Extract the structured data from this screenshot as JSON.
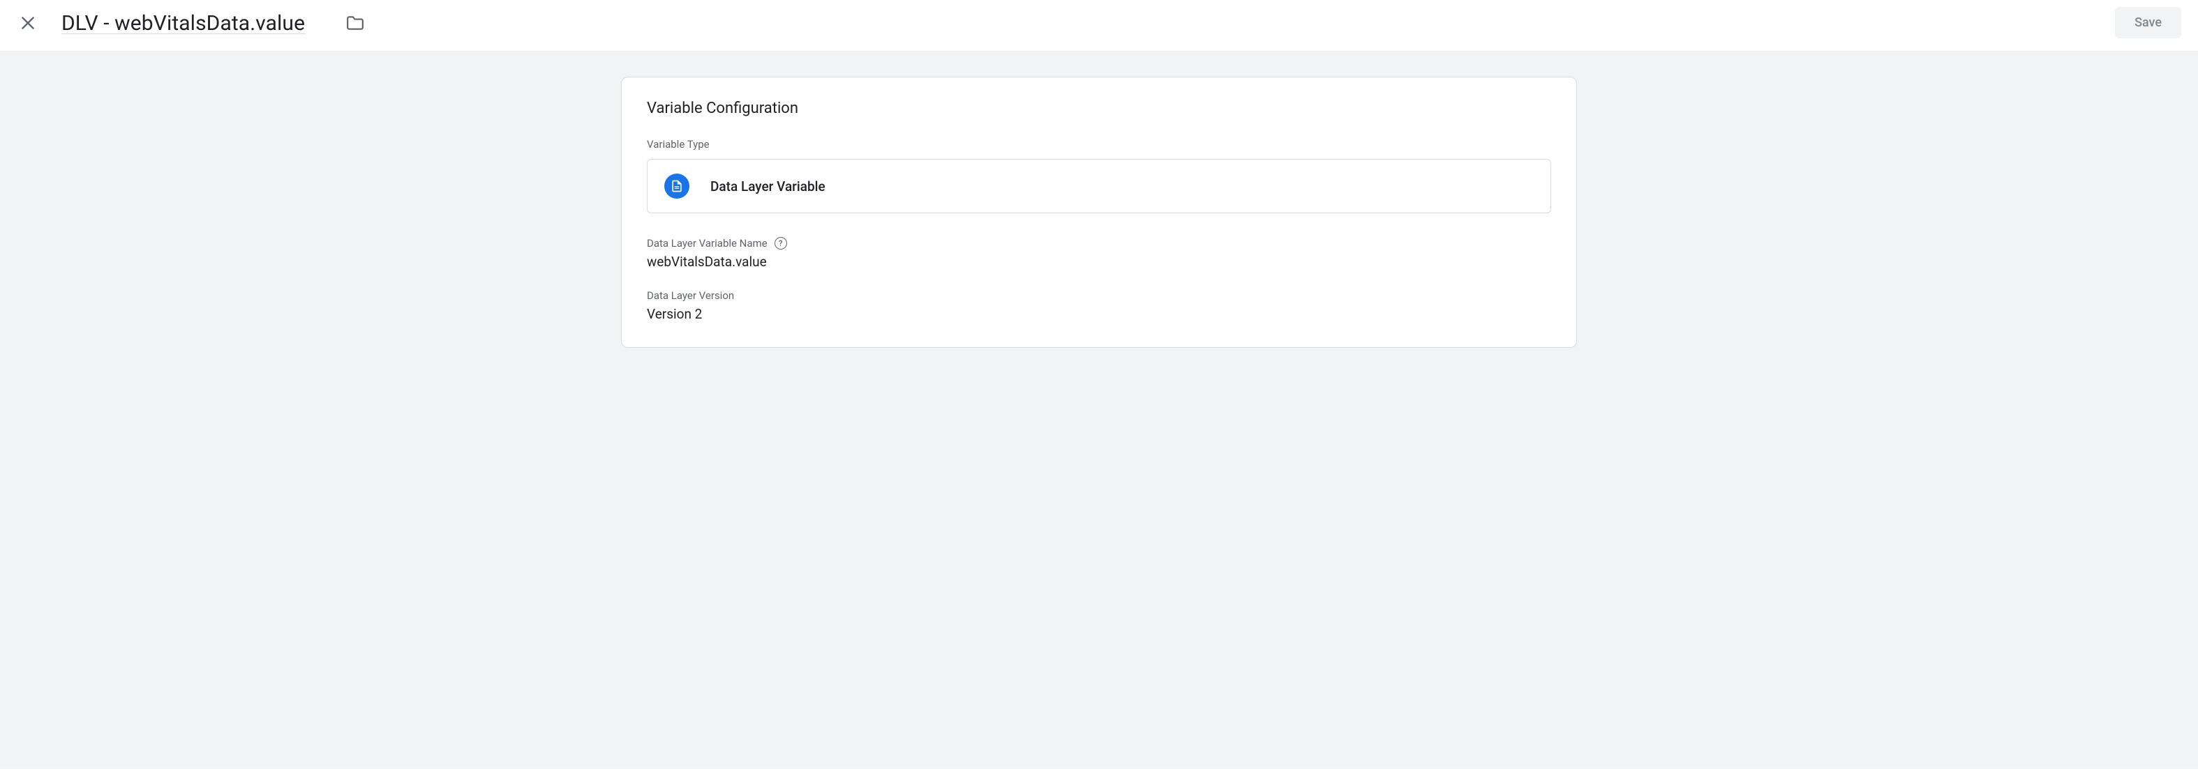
{
  "header": {
    "title": "DLV - webVitalsData.value",
    "save_label": "Save"
  },
  "config": {
    "card_title": "Variable Configuration",
    "type_section_label": "Variable Type",
    "type_name": "Data Layer Variable",
    "var_name_label": "Data Layer Variable Name",
    "var_name_value": "webVitalsData.value",
    "version_label": "Data Layer Version",
    "version_value": "Version 2"
  }
}
